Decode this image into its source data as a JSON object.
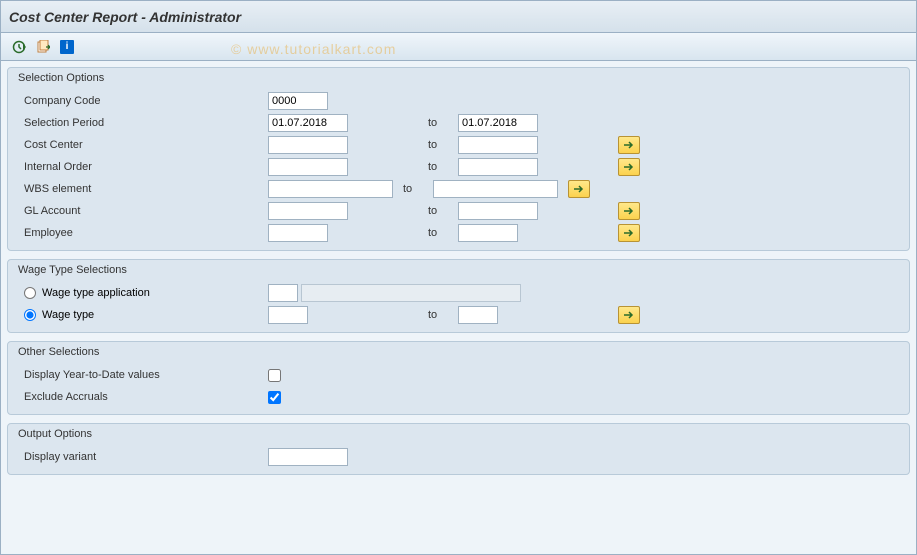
{
  "title": "Cost Center Report - Administrator",
  "watermark": "© www.tutorialkart.com",
  "groups": {
    "selection": {
      "title": "Selection Options",
      "company_code": {
        "label": "Company Code",
        "value": "0000"
      },
      "selection_period": {
        "label": "Selection Period",
        "from": "01.07.2018",
        "to_label": "to",
        "to": "01.07.2018"
      },
      "cost_center": {
        "label": "Cost Center",
        "to_label": "to"
      },
      "internal_order": {
        "label": "Internal Order",
        "to_label": "to"
      },
      "wbs_element": {
        "label": "WBS element",
        "to_label": "to"
      },
      "gl_account": {
        "label": "GL Account",
        "to_label": "to"
      },
      "employee": {
        "label": "Employee",
        "to_label": "to"
      }
    },
    "wage": {
      "title": "Wage Type Selections",
      "wage_type_application": {
        "label": "Wage type application"
      },
      "wage_type": {
        "label": "Wage type",
        "to_label": "to"
      }
    },
    "other": {
      "title": "Other Selections",
      "ytd": {
        "label": "Display Year-to-Date values",
        "checked": false
      },
      "exclude_accruals": {
        "label": "Exclude Accruals",
        "checked": true
      }
    },
    "output": {
      "title": "Output Options",
      "display_variant": {
        "label": "Display variant"
      }
    }
  }
}
